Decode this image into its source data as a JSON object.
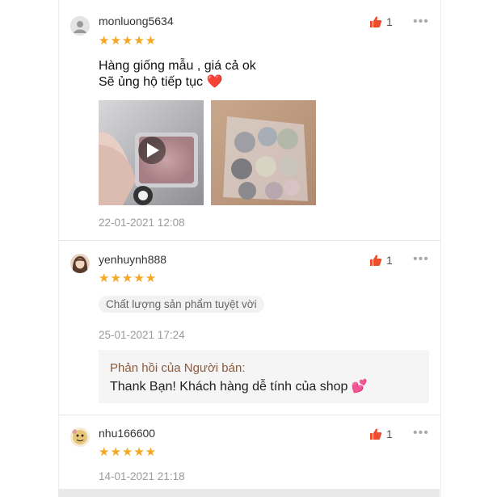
{
  "reviews": [
    {
      "username": "monluong5634",
      "stars": "★★★★★",
      "likes": "1",
      "more": "•••",
      "text_line1": "Hàng giống mẫu , giá cả ok",
      "text_line2": "Sẽ ủng hộ tiếp tục",
      "heart": "❤️",
      "date": "22-01-2021 12:08"
    },
    {
      "username": "yenhuynh888",
      "stars": "★★★★★",
      "likes": "1",
      "more": "•••",
      "tag": "Chất lượng sản phẩm tuyệt vời",
      "date": "25-01-2021 17:24",
      "seller_label": "Phản hồi của Người bán:",
      "seller_reply": "Thank Bạn! Khách hàng dễ tính của shop",
      "seller_emoji": "💕"
    },
    {
      "username": "nhu166600",
      "stars": "★★★★★",
      "likes": "1",
      "more": "•••",
      "date": "14-01-2021 21:18"
    }
  ],
  "colors": {
    "star": "#f5a623",
    "like": "#ee4d2d",
    "seller_label": "#8a5a3c"
  }
}
